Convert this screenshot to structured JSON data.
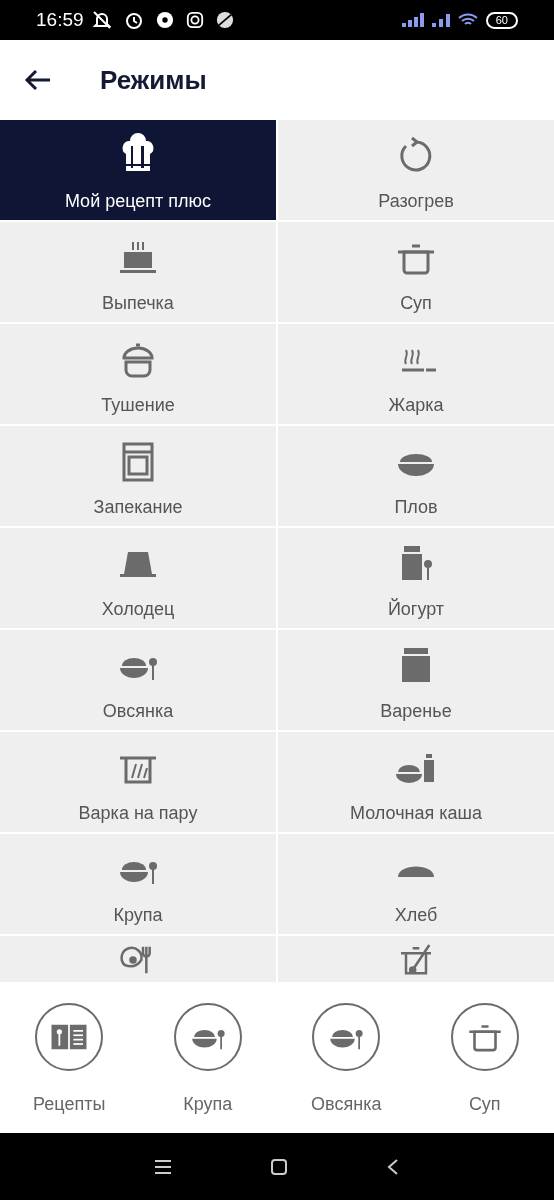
{
  "status_bar": {
    "time": "16:59",
    "battery": "60"
  },
  "header": {
    "title": "Режимы"
  },
  "modes": [
    {
      "label": "Мой рецепт плюс",
      "selected": true
    },
    {
      "label": "Разогрев",
      "selected": false
    },
    {
      "label": "Выпечка",
      "selected": false
    },
    {
      "label": "Суп",
      "selected": false
    },
    {
      "label": "Тушение",
      "selected": false
    },
    {
      "label": "Жарка",
      "selected": false
    },
    {
      "label": "Запекание",
      "selected": false
    },
    {
      "label": "Плов",
      "selected": false
    },
    {
      "label": "Холодец",
      "selected": false
    },
    {
      "label": "Йогурт",
      "selected": false
    },
    {
      "label": "Овсянка",
      "selected": false
    },
    {
      "label": "Варенье",
      "selected": false
    },
    {
      "label": "Варка на пару",
      "selected": false
    },
    {
      "label": "Молочная каша",
      "selected": false
    },
    {
      "label": "Крупа",
      "selected": false
    },
    {
      "label": "Хлеб",
      "selected": false
    },
    {
      "selected": false
    },
    {
      "selected": false
    }
  ],
  "quick_bar": [
    {
      "label": "Рецепты"
    },
    {
      "label": "Крупа"
    },
    {
      "label": "Овсянка"
    },
    {
      "label": "Суп"
    }
  ]
}
